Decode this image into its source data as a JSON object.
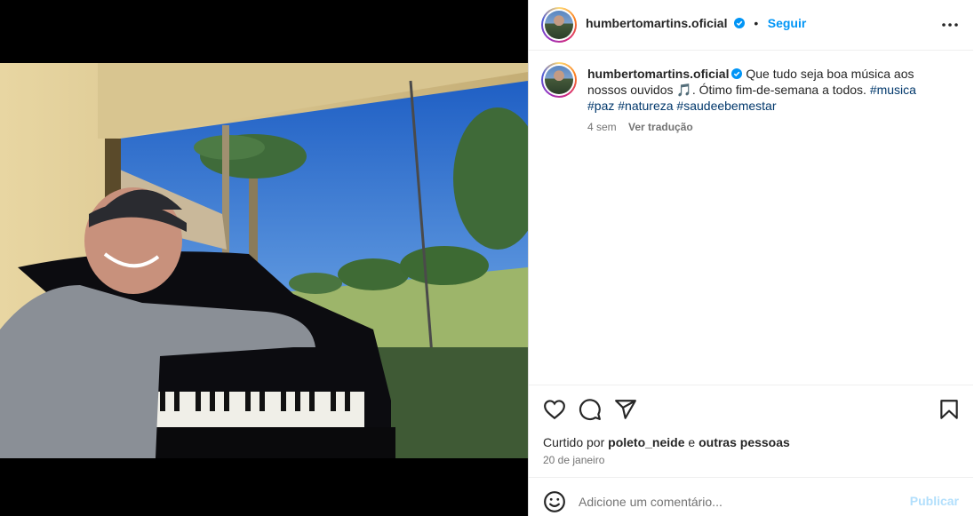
{
  "post": {
    "username": "humbertomartins.oficial",
    "follow_label": "Seguir",
    "separator": "•",
    "caption": {
      "text": "Que tudo seja boa música aos nossos ouvidos",
      "emoji": "🎵",
      "text2": ". Ótimo fim-de-semana a todos.",
      "hashtags": [
        "#musica",
        "#paz",
        "#natureza",
        "#saudeebemestar"
      ]
    },
    "time_ago": "4 sem",
    "translate_label": "Ver tradução",
    "likes": {
      "prefix": "Curtido por",
      "user": "poleto_neide",
      "connector": "e",
      "others": "outras pessoas"
    },
    "date": "20 de janeiro",
    "comment_placeholder": "Adicione um comentário...",
    "publish_label": "Publicar"
  },
  "colors": {
    "accent": "#0095f6",
    "hashtag": "#00376b",
    "muted": "#737373",
    "publish_disabled": "#b2dffc"
  },
  "icons": [
    "verified-badge-icon",
    "more-options-icon",
    "heart-icon",
    "comment-icon",
    "share-icon",
    "bookmark-icon",
    "emoji-icon"
  ]
}
